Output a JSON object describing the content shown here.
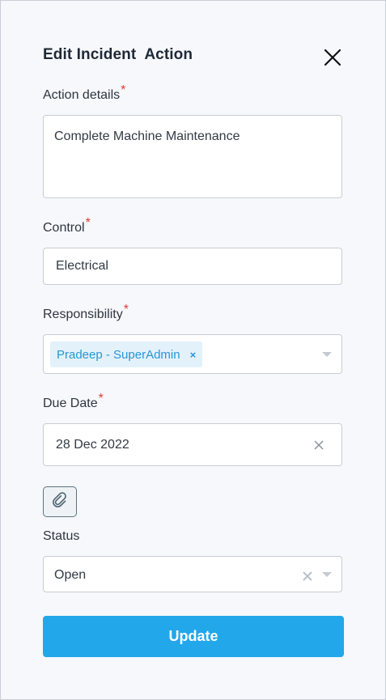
{
  "dialog": {
    "title": "Edit Incident  Action",
    "close_icon": "close-icon"
  },
  "action_details": {
    "label": "Action details",
    "required_mark": "*",
    "value": "Complete Machine Maintenance"
  },
  "control": {
    "label": "Control",
    "required_mark": "*",
    "value": "Electrical"
  },
  "responsibility": {
    "label": "Responsibility",
    "required_mark": "*",
    "tags": [
      {
        "label": "Pradeep - SuperAdmin",
        "remove": "×"
      }
    ],
    "dropdown_icon": "caret-down-icon"
  },
  "due_date": {
    "label": "Due Date",
    "required_mark": "*",
    "value": "28 Dec 2022",
    "clear_icon": "clear-icon"
  },
  "attachment": {
    "icon": "paperclip-icon"
  },
  "status": {
    "label": "Status",
    "value": "Open",
    "clear_icon": "clear-icon",
    "dropdown_icon": "caret-down-icon"
  },
  "submit": {
    "label": "Update"
  },
  "colors": {
    "accent": "#22a7ea",
    "required": "#e53935",
    "tag_bg": "#e3f1fb",
    "tag_text": "#2696d6",
    "background": "#f6f8fb"
  }
}
